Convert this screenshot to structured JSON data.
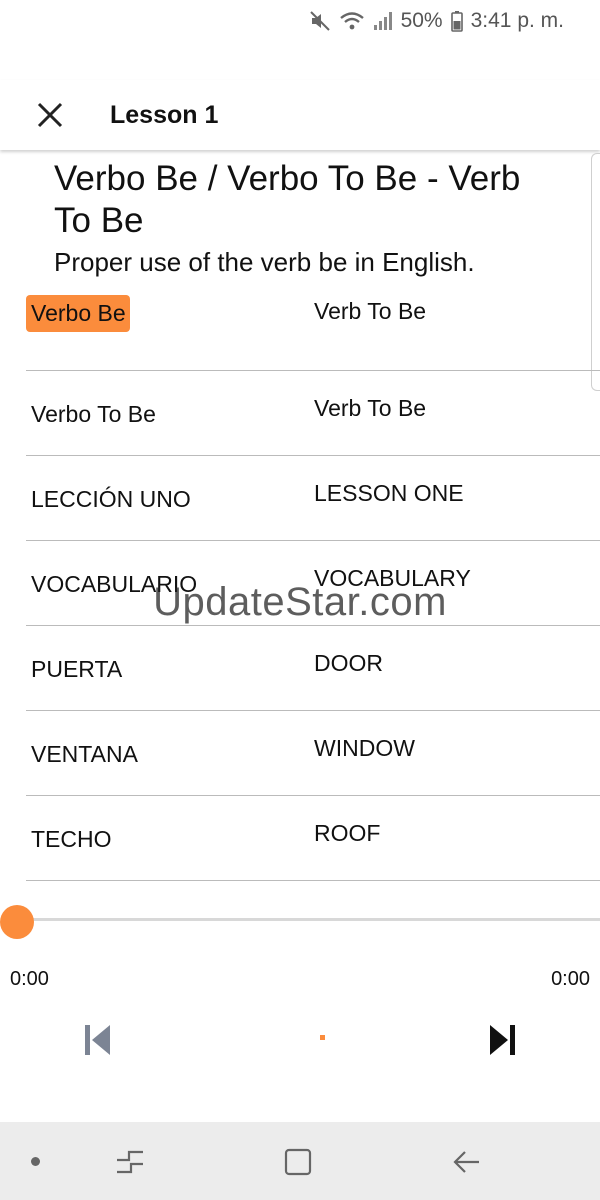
{
  "status_bar": {
    "battery": "50%",
    "time": "3:41 p. m.",
    "icons": [
      "mute-icon",
      "wifi-icon",
      "signal-icon",
      "battery-icon"
    ]
  },
  "app_bar": {
    "close_icon": "close-icon",
    "title": "Lesson 1"
  },
  "lesson": {
    "title": "Verbo Be / Verbo To Be - Verb To Be",
    "subtitle": "Proper use of the verb be in English."
  },
  "vocab": [
    {
      "es": "Verbo Be",
      "en": "Verb To Be"
    },
    {
      "es": "Verbo To Be",
      "en": "Verb To Be"
    },
    {
      "es": "LECCIÓN UNO",
      "en": "LESSON ONE"
    },
    {
      "es": "VOCABULARIO",
      "en": "VOCABULARY"
    },
    {
      "es": "PUERTA",
      "en": "DOOR"
    },
    {
      "es": "VENTANA",
      "en": "WINDOW"
    },
    {
      "es": "TECHO",
      "en": "ROOF"
    }
  ],
  "watermark": "UpdateStar.com",
  "player": {
    "elapsed": "0:00",
    "duration": "0:00",
    "progress": 0,
    "accent_color": "#fb8c3c"
  },
  "nav_bar": {
    "icons": [
      "recent-apps-icon",
      "home-icon",
      "back-icon"
    ]
  }
}
